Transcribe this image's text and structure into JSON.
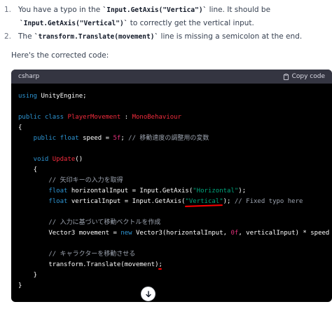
{
  "list": [
    {
      "number": "1.",
      "text_a": "You have a typo in the ",
      "code_a": "`Input.GetAxis(\"Vertica\")`",
      "text_b": " line. It should be",
      "code_b": "`Input.GetAxis(\"Vertical\")`",
      "text_c": " to correctly get the vertical input."
    },
    {
      "number": "2.",
      "text_a": "The ",
      "code_a": "`transform.Translate(movement)`",
      "text_b": " line is missing a semicolon at the end."
    }
  ],
  "intro": "Here's the corrected code:",
  "codeblock": {
    "language": "csharp",
    "copy_label": "Copy code"
  },
  "code": {
    "l1a": "using",
    "l1b": " UnityEngine;",
    "l2a": "public",
    "l2b": "class",
    "l2c": "PlayerMovement",
    "l2d": " : ",
    "l2e": "MonoBehaviour",
    "l3": "{",
    "l4a": "    public",
    "l4b": "float",
    "l4c": " speed = ",
    "l4d": "5f",
    "l4e": "; ",
    "l4f": "// 移動速度の調整用の変数",
    "l5a": "    void",
    "l5b": "Update",
    "l5c": "()",
    "l6": "    {",
    "l7": "        // 矢印キーの入力を取得",
    "l8a": "        float",
    "l8b": " horizontalInput = Input.GetAxis(",
    "l8c": "\"Horizontal\"",
    "l8d": ");",
    "l9a": "        float",
    "l9b": " verticalInput = Input.GetAxis(",
    "l9c": "\"Vertical\"",
    "l9d": "); ",
    "l9e": "// Fixed typo here",
    "l10": "        // 入力に基づいて移動ベクトルを作成",
    "l11a": "        Vector3 movement = ",
    "l11b": "new",
    "l11c": " Vector3(horizontalInput, ",
    "l11d": "0f",
    "l11e": ", verticalInput) * speed *",
    "l12": "        // キャラクターを移動させる",
    "l13a": "        transform.Translate(movement)",
    "l13b": ";",
    "l14": "    }",
    "l15": "}"
  },
  "colors": {
    "code_bg": "#000000",
    "header_bg": "#343541",
    "keyword": "#2e95d3",
    "class_name": "#f22c3d",
    "string": "#00a67d",
    "number": "#df3079",
    "annotation": "#ff0000"
  },
  "icons": {
    "copy": "clipboard-icon",
    "scroll": "arrow-down-icon"
  }
}
